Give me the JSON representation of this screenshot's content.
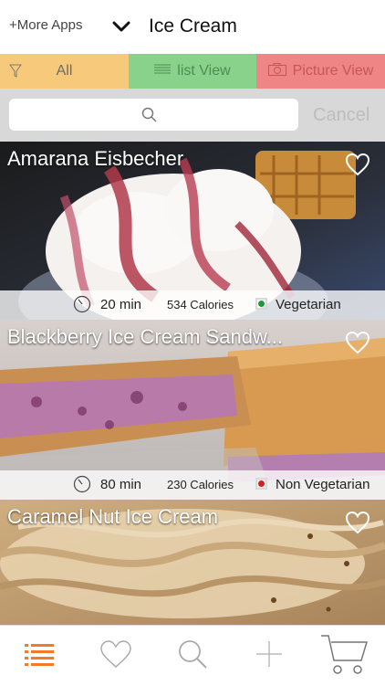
{
  "header": {
    "more_apps": "+More Apps",
    "title": "Ice Cream",
    "chevron_icon": "chevron-down-icon"
  },
  "filters": [
    {
      "label": "All",
      "icon": "filter-icon",
      "color": "#f7c97a"
    },
    {
      "label": "list View",
      "icon": "list-icon",
      "color": "#88d28b"
    },
    {
      "label": "Picture View",
      "icon": "camera-icon",
      "color": "#ef8585"
    }
  ],
  "search": {
    "placeholder": "",
    "cancel_label": "Cancel"
  },
  "recipes": [
    {
      "name": "Amarana Eisbecher",
      "time": "20 min",
      "calories": "534 Calories",
      "diet": "Vegetarian",
      "diet_color": "#1a9a3a"
    },
    {
      "name": "Blackberry Ice Cream Sandw...",
      "time": "80 min",
      "calories": "230 Calories",
      "diet": "Non Vegetarian",
      "diet_color": "#d42020"
    },
    {
      "name": "Caramel Nut Ice Cream"
    }
  ],
  "tabbar": {
    "active_color": "#f07b2a",
    "tabs": [
      "list-icon",
      "heart-icon",
      "search-icon",
      "add-icon",
      "cart-icon"
    ]
  }
}
